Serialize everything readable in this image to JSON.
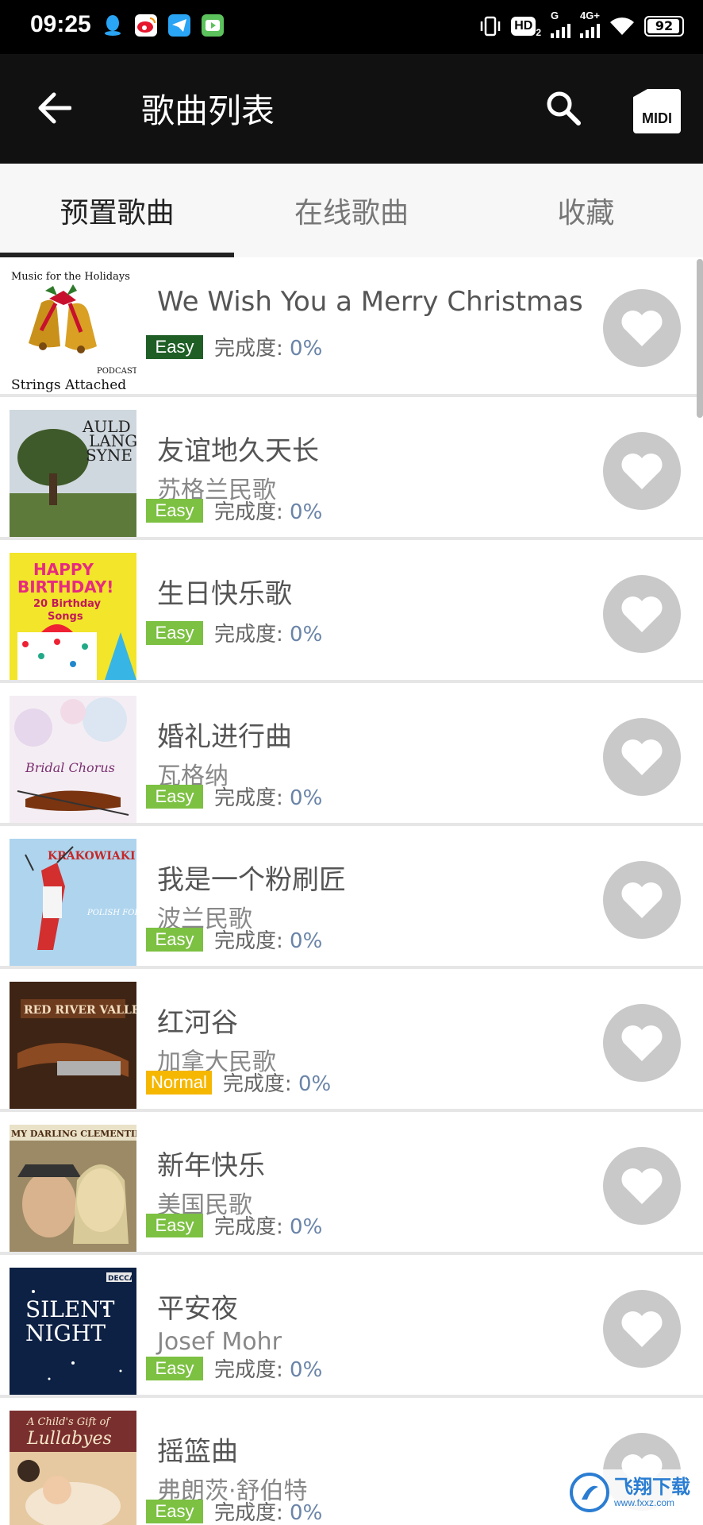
{
  "status_bar": {
    "time": "09:25",
    "app_icons": [
      "qq-icon",
      "weibo-icon",
      "telegram-icon",
      "video-app-icon"
    ],
    "hd_label": "HD",
    "hd_sub": "2",
    "network_g": "G",
    "network_4g": "4G+",
    "battery": "92"
  },
  "header": {
    "title": "歌曲列表",
    "midi_label": "MIDI"
  },
  "tabs": [
    {
      "label": "预置歌曲",
      "active": true
    },
    {
      "label": "在线歌曲",
      "active": false
    },
    {
      "label": "收藏",
      "active": false
    }
  ],
  "progress_label": "完成度:",
  "songs": [
    {
      "title": "We Wish You a Merry Christmas",
      "subtitle": "",
      "level": "Easy",
      "progress": "0%",
      "cover": "christmas-bells"
    },
    {
      "title": "友谊地久天长",
      "subtitle": "苏格兰民歌",
      "level": "Easy",
      "progress": "0%",
      "cover": "auld-lang-syne"
    },
    {
      "title": "生日快乐歌",
      "subtitle": "",
      "level": "Easy",
      "progress": "0%",
      "cover": "happy-birthday"
    },
    {
      "title": "婚礼进行曲",
      "subtitle": "瓦格纳",
      "level": "Easy",
      "progress": "0%",
      "cover": "bridal-chorus"
    },
    {
      "title": "我是一个粉刷匠",
      "subtitle": "波兰民歌",
      "level": "Easy",
      "progress": "0%",
      "cover": "krakowiaki"
    },
    {
      "title": "红河谷",
      "subtitle": "加拿大民歌",
      "level": "Normal",
      "progress": "0%",
      "cover": "red-river-valley"
    },
    {
      "title": "新年快乐",
      "subtitle": "美国民歌",
      "level": "Easy",
      "progress": "0%",
      "cover": "my-darling-clementine"
    },
    {
      "title": "平安夜",
      "subtitle": "Josef Mohr",
      "level": "Easy",
      "progress": "0%",
      "cover": "silent-night"
    },
    {
      "title": "摇篮曲",
      "subtitle": "弗朗茨·舒伯特",
      "level": "Easy",
      "progress": "0%",
      "cover": "lullabyes"
    }
  ],
  "cover_texts": {
    "christmas_top": "Music for the Holidays",
    "christmas_podcast": "PODCAST",
    "christmas_bottom": "Strings Attached",
    "auld_1": "AULD",
    "auld_2": "LANG",
    "auld_3": "SYNE",
    "birthday_1": "HAPPY",
    "birthday_2": "BIRTHDAY!",
    "birthday_3": "20 Birthday",
    "birthday_4": "Songs",
    "bridal": "Bridal Chorus",
    "krakowiaki": "KRAKOWIAKI",
    "krak_sub": "POLISH FOLK MUSIC",
    "red_river": "RED RIVER VALLEY",
    "clementine": "MY DARLING CLEMENTINE",
    "silent_1": "SILENT",
    "silent_2": "NIGHT",
    "decca": "DECCA",
    "lullaby_1": "A Child's Gift of",
    "lullaby_2": "Lullabyes"
  },
  "colors": {
    "easy_dark": "#1f5f26",
    "easy": "#7cc142",
    "normal": "#f5b700",
    "header_bg": "#111111",
    "fav_bg": "#c9c9c9"
  },
  "watermark": {
    "main": "飞翔下载",
    "sub": "www.fxxz.com"
  }
}
